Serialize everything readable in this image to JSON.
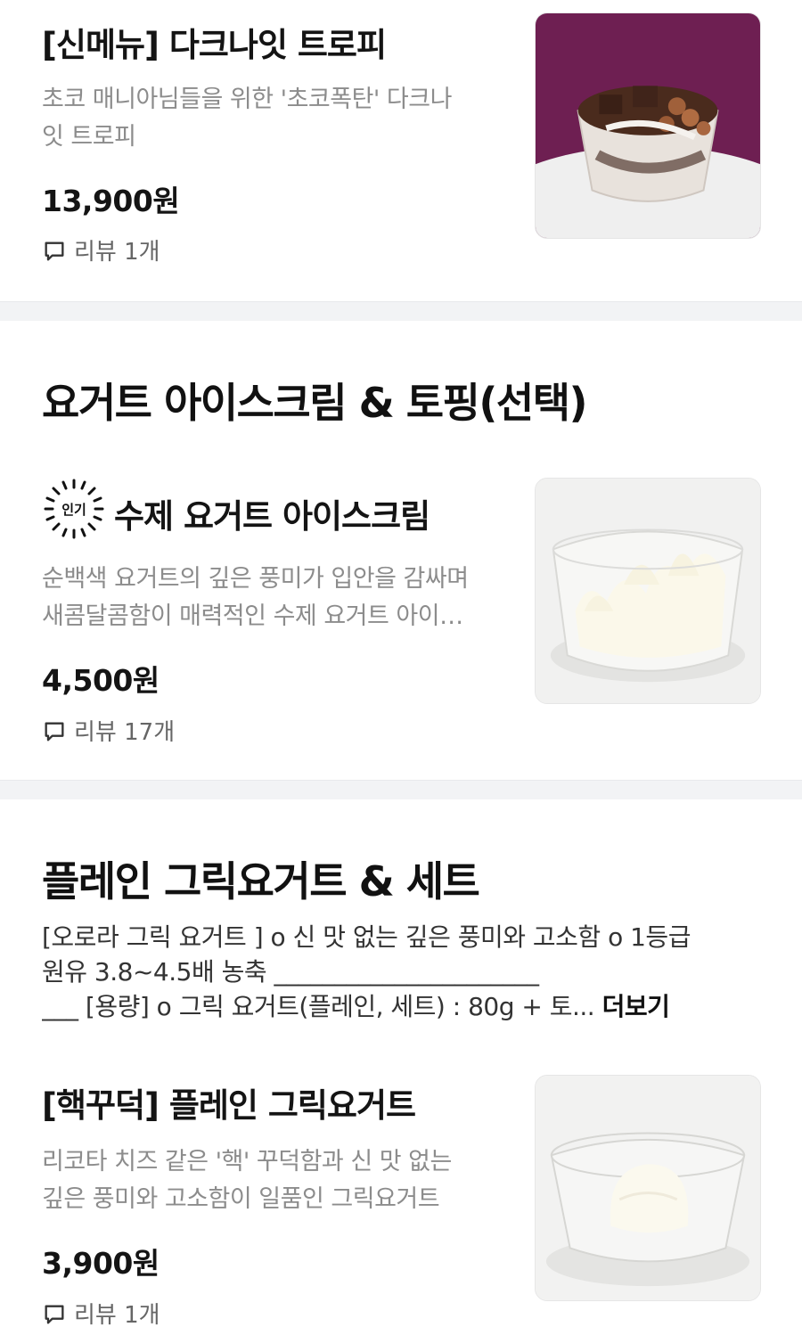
{
  "items": [
    {
      "name": "[신메뉴] 다크나잇 트로피",
      "desc_lines": [
        "초코 매니아님들을 위한 '초코폭탄' 다크나",
        "잇 트로피"
      ],
      "price": "13,900원",
      "review": "리뷰 1개",
      "photo_icon": "chocolate-trophy-photo"
    },
    {
      "badge": "인기",
      "name": "수제 요거트 아이스크림",
      "desc_lines": [
        "순백색 요거트의 깊은 풍미가 입안을 감싸며",
        "새콤달콤함이 매력적인 수제 요거트 아이…"
      ],
      "price": "4,500원",
      "review": "리뷰 17개",
      "photo_icon": "yogurt-ice-cream-photo"
    },
    {
      "name": "[핵꾸덕] 플레인 그릭요거트",
      "desc_lines": [
        "리코타 치즈 같은 '핵' 꾸덕함과 신 맛 없는",
        "깊은 풍미와 고소함이 일품인 그릭요거트"
      ],
      "price": "3,900원",
      "review": "리뷰 1개",
      "photo_icon": "greek-yogurt-photo"
    }
  ],
  "sections": [
    {
      "title": "요거트 아이스크림 & 토핑(선택)"
    },
    {
      "title": "플레인 그릭요거트 & 세트",
      "desc_lines": [
        "[오로라 그릭 요거트 ] o 신 맛 없는 깊은 풍미와 고소함 o 1등급",
        "원유 3.8~4.5배 농축 ______________________",
        "___ [용량] o 그릭 요거트(플레인, 세트) : 80g + 토... "
      ],
      "more_label": "더보기"
    }
  ],
  "colors": {
    "divider": "#f2f3f5",
    "desc_gray": "#8c8c8c",
    "trophy_bg": "#6e1f52"
  }
}
